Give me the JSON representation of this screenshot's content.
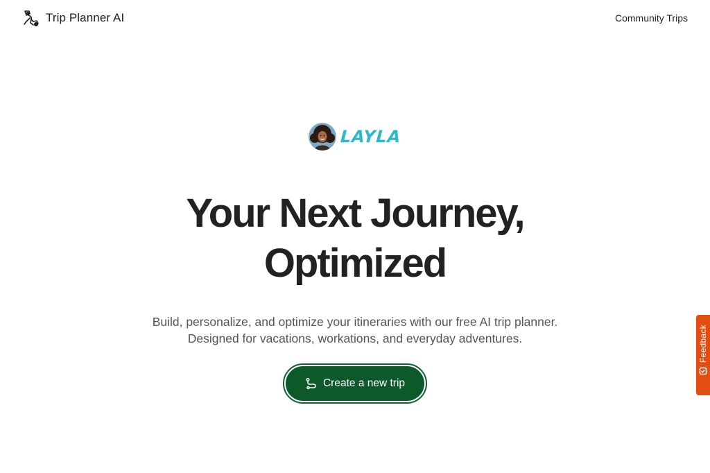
{
  "header": {
    "brand_name": "Trip Planner AI",
    "logo_icon": "traveler-logo-icon",
    "nav_link": "Community Trips"
  },
  "hero": {
    "persona_name": "LAYLA",
    "avatar_icon": "layla-avatar",
    "headline_line1": "Your Next Journey,",
    "headline_line2": "Optimized",
    "subtitle": "Build, personalize, and optimize your itineraries with our free AI trip planner. Designed for vacations, workations, and everyday adventures.",
    "cta_label": "Create a new trip",
    "cta_icon": "route-icon"
  },
  "feedback": {
    "label": "Feedback",
    "icon": "checkbox-icon"
  },
  "colors": {
    "accent_green": "#0c5a2a",
    "persona_teal": "#2fb9c8",
    "feedback_orange": "#e24e12",
    "text_dark": "#222222",
    "text_muted": "#555555"
  }
}
